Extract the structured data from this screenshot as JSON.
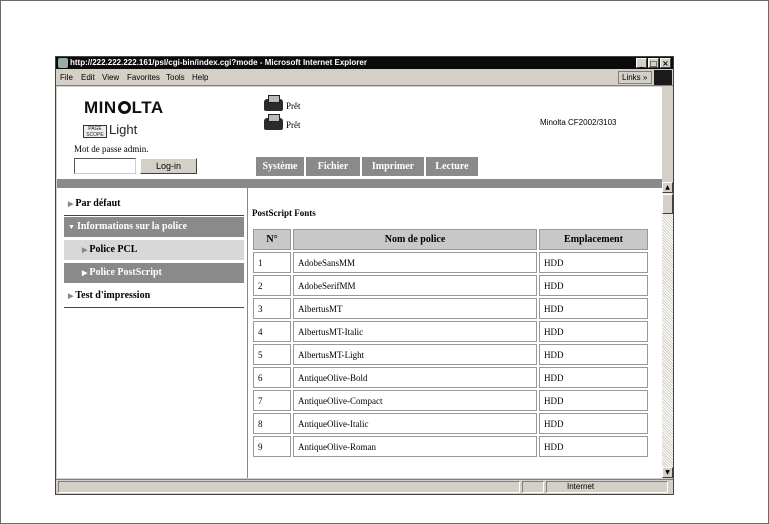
{
  "browser": {
    "title": "http://222.222.222.161/psl/cgi-bin/index.cgi?mode - Microsoft Internet Explorer",
    "menu": [
      "File",
      "Edit",
      "View",
      "Favorites",
      "Tools",
      "Help"
    ],
    "links_label": "Links »",
    "window_buttons": [
      "_",
      "□",
      "×"
    ],
    "status_zone": "Internet"
  },
  "header": {
    "brand": "MINOLTA",
    "brand_prefix": "MIN",
    "brand_suffix": "LTA",
    "pagescope_mark": "PAGE SCOPE",
    "pagescope_text": "Light",
    "password_label": "Mot de passe admin.",
    "login_button": "Log-in",
    "status_1": "Prêt",
    "status_2": "Prêt",
    "model": "Minolta CF2002/3103"
  },
  "tabs": [
    "Système",
    "Fichier",
    "Imprimer",
    "Lecture"
  ],
  "nav": {
    "par_defaut": "Par défaut",
    "informations": "Informations sur la police",
    "police_pcl": "Police PCL",
    "police_postscript": "Police PostScript",
    "test": "Test d'impression"
  },
  "main": {
    "section_title": "PostScript Fonts",
    "columns": [
      "N°",
      "Nom de police",
      "Emplacement"
    ],
    "rows": [
      [
        "1",
        "AdobeSansMM",
        "HDD"
      ],
      [
        "2",
        "AdobeSerifMM",
        "HDD"
      ],
      [
        "3",
        "AlbertusMT",
        "HDD"
      ],
      [
        "4",
        "AlbertusMT-Italic",
        "HDD"
      ],
      [
        "5",
        "AlbertusMT-Light",
        "HDD"
      ],
      [
        "6",
        "AntiqueOlive-Bold",
        "HDD"
      ],
      [
        "7",
        "AntiqueOlive-Compact",
        "HDD"
      ],
      [
        "8",
        "AntiqueOlive-Italic",
        "HDD"
      ],
      [
        "9",
        "AntiqueOlive-Roman",
        "HDD"
      ]
    ]
  }
}
